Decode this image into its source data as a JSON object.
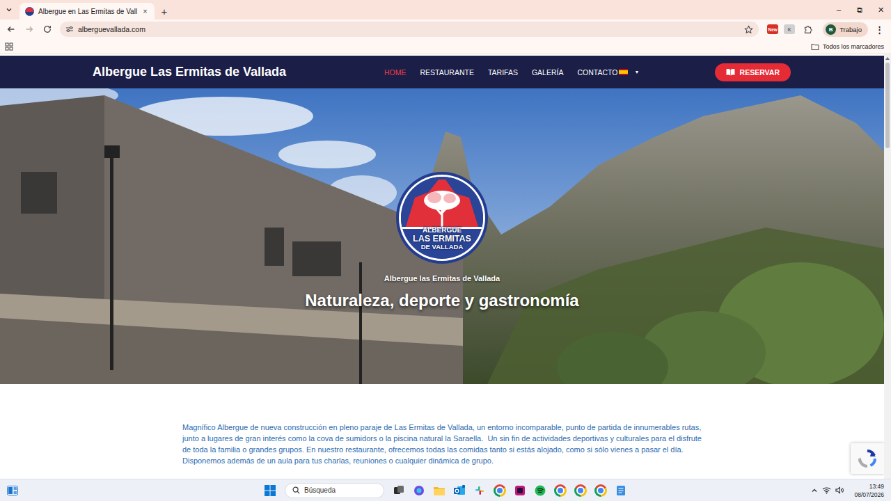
{
  "browser": {
    "tabs": [
      {
        "title": "Albergue en Las Ermitas de Vall",
        "selected": true,
        "close": "×"
      }
    ],
    "new_tab": "+",
    "window_controls": [
      "–",
      "⧉",
      "✕"
    ],
    "forward_disabled": true,
    "url": "alberguevallada.com",
    "extensions": [
      {
        "label": "New",
        "color": "#d93025"
      },
      {
        "label": "K",
        "color": "#d0d0d0"
      }
    ],
    "profile": {
      "initial": "B",
      "label": "Trabajo"
    },
    "menu": "⋮",
    "bookmarks_folder": "Todos los marcadores"
  },
  "site": {
    "brand": "Albergue Las Ermitas de Vallada",
    "nav": [
      {
        "label": "HOME",
        "selected": true
      },
      {
        "label": "RESTAURANTE",
        "selected": false
      },
      {
        "label": "TARIFAS",
        "selected": false
      },
      {
        "label": "GALERÍA",
        "selected": false
      },
      {
        "label": "CONTACTO",
        "selected": false
      }
    ],
    "language_caret": "▼",
    "reserve_button": "RESERVAR",
    "hero": {
      "logo_lines": [
        "ALBERGUE",
        "LAS ERMITAS",
        "DE VALLADA"
      ],
      "subtitle": "Albergue las Ermitas de Vallada",
      "title": "Naturaleza, deporte y gastronomía"
    },
    "intro": "Magnífico Albergue de nueva construcción en pleno paraje de Las Ermitas de Vallada, un entorno incomparable, punto de partida de innumerables rutas, junto a lugares de gran interés como la cova de sumidors o la piscina natural la Saraella.  Un sin fin de actividades deportivas y culturales para el disfrute de toda la familia o grandes grupos. En nuestro restaurante, ofrecemos todas las comidas tanto si estás alojado, como si sólo vienes a pasar el día. Disponemos además de un aula para tus charlas, reuniones o cualquier dinámica de grupo."
  },
  "taskbar": {
    "search": "Búsqueda",
    "time": "13:49",
    "date": "08/07/2026"
  }
}
